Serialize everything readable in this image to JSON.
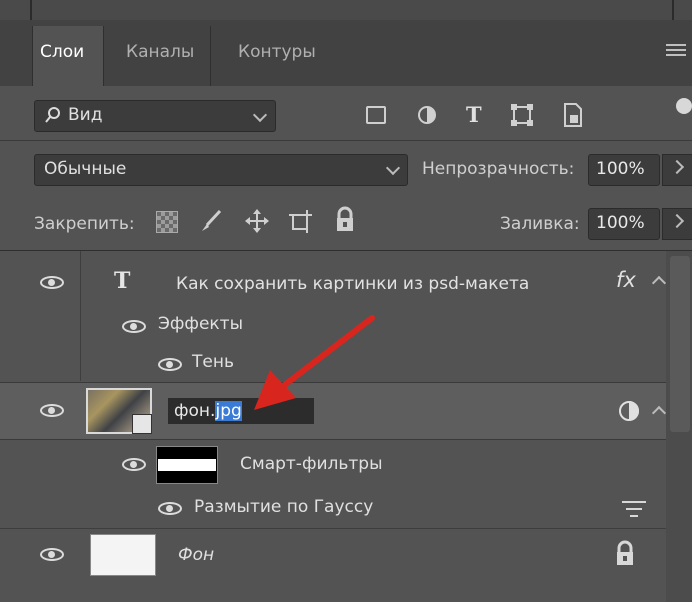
{
  "tabs": [
    {
      "label": "Слои"
    },
    {
      "label": "Каналы"
    },
    {
      "label": "Контуры"
    }
  ],
  "filter": {
    "label": "Вид"
  },
  "blend": {
    "mode": "Обычные",
    "opacity_label": "Непрозрачность:",
    "opacity_value": "100%"
  },
  "lock": {
    "label": "Закрепить:",
    "fill_label": "Заливка:",
    "fill_value": "100%"
  },
  "layers": {
    "text_layer": {
      "type_glyph": "T",
      "name": "Как сохранить картинки  из psd-макета",
      "fx": "fx"
    },
    "effects": {
      "label": "Эффекты"
    },
    "shadow": {
      "label": "Тень"
    },
    "smart_layer": {
      "name_prefix": "фон.",
      "name_selected": "jpg"
    },
    "smart_filters": {
      "label": "Смарт-фильтры"
    },
    "gauss": {
      "label": "Размытие по Гауссу"
    },
    "bg_layer": {
      "name": "Фон"
    }
  },
  "colors": {
    "accent": "#3a7bd5",
    "arrow": "#d8261f",
    "panel": "#535353"
  }
}
